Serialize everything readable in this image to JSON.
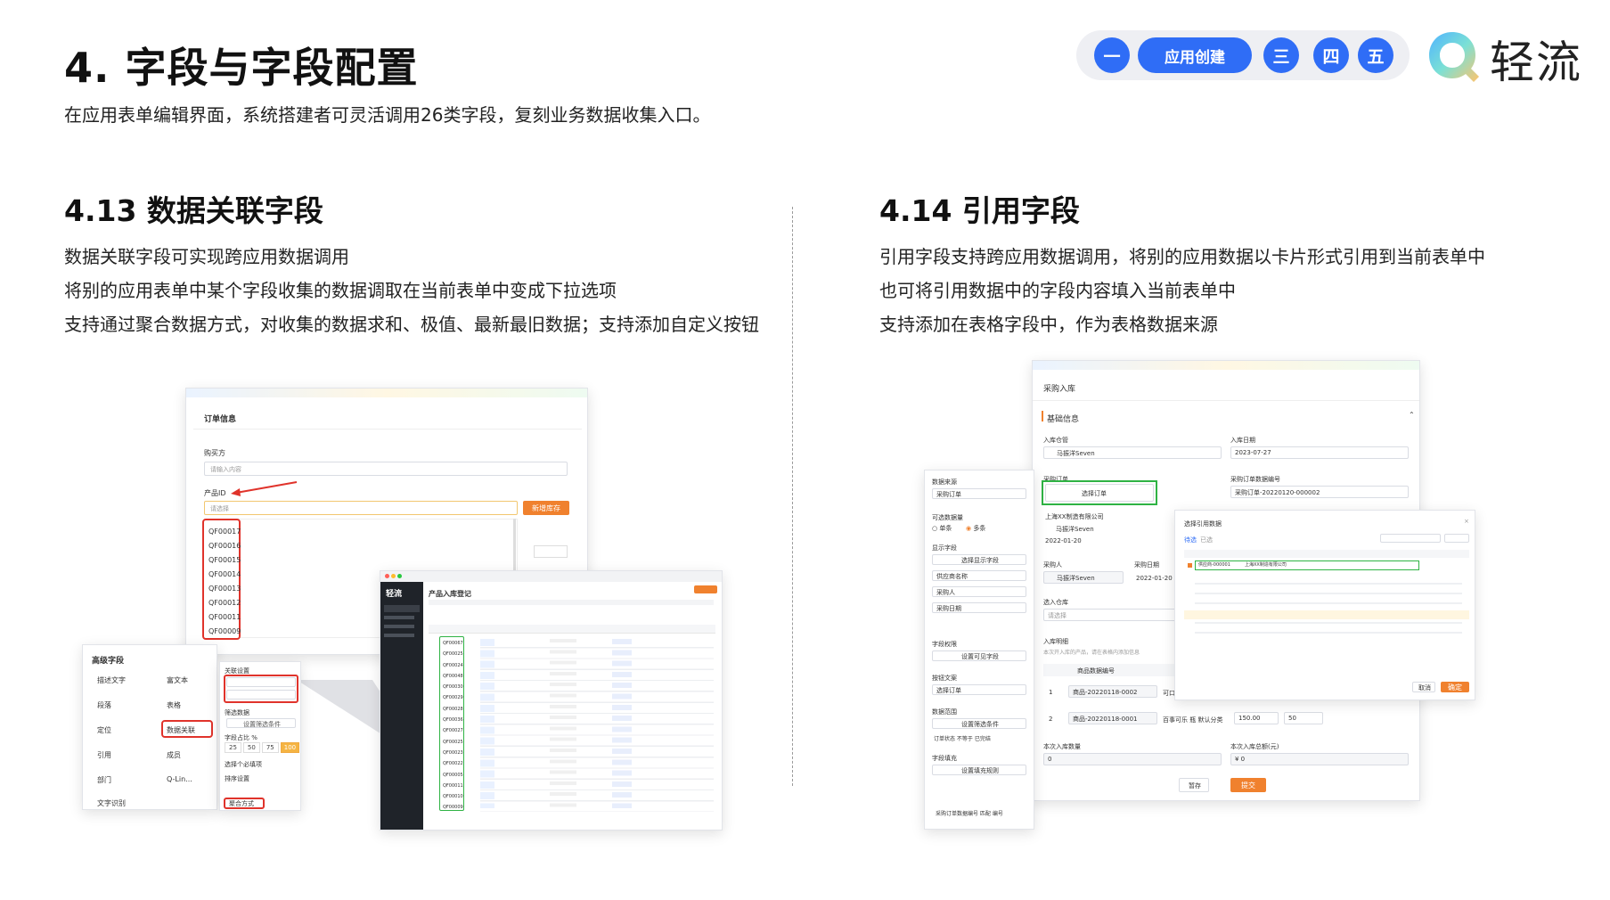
{
  "header": {
    "title": "4. 字段与字段配置",
    "subtitle": "在应用表单编辑界面，系统搭建者可灵活调用26类字段，复刻业务数据收集入口。"
  },
  "nav": {
    "items": [
      "一",
      "应用创建",
      "三",
      "四",
      "五"
    ],
    "active_color": "#2f6df6"
  },
  "logo": {
    "text": "轻流"
  },
  "left_section": {
    "title": "4.13 数据关联字段",
    "lines": [
      "数据关联字段可实现跨应用数据调用",
      "将别的应用表单中某个字段收集的数据调取在当前表单中变成下拉选项",
      "支持通过聚合数据方式，对收集的数据求和、极值、最新最旧数据；支持添加自定义按钮"
    ]
  },
  "right_section": {
    "title": "4.14 引用字段",
    "lines": [
      "引用字段支持跨应用数据调用，将别的应用数据以卡片形式引用到当前表单中",
      "也可将引用数据中的字段内容填入当前表单中",
      "支持添加在表格字段中，作为表格数据来源"
    ]
  },
  "mock_order": {
    "title": "订单信息",
    "buyer_label": "购买方",
    "buyer_placeholder": "请输入内容",
    "product_label": "产品ID",
    "select_placeholder": "请选择",
    "add_button": "新增库存",
    "options": [
      "QF00017",
      "QF00016",
      "QF00015",
      "QF00014",
      "QF00013",
      "QF00012",
      "QF00011",
      "QF00009"
    ]
  },
  "mock_fields": {
    "title": "高级字段",
    "items": [
      "描述文字",
      "富文本",
      "段落",
      "表格",
      "定位",
      "数据关联",
      "引用",
      "成员",
      "部门",
      "Q-Lin...",
      "文字识别"
    ],
    "config": {
      "label1": "关联设置",
      "label2": "筛选数据",
      "btn1": "设置筛选条件",
      "label3": "字段占比 %",
      "ratios": [
        "25",
        "50",
        "75",
        "100"
      ],
      "check1": "选择个必填项",
      "label4": "排序设置",
      "agg": "聚合方式"
    }
  },
  "mock_table": {
    "brand": "轻流",
    "page_title": "产品入库登记",
    "rows": [
      "QF00067",
      "QF00025",
      "QF00024",
      "QF00048",
      "QF00030",
      "QF00029",
      "QF00028",
      "QF00036",
      "QF00027",
      "QF00025",
      "QF00023",
      "QF00022",
      "QF00005",
      "QF00011",
      "QF00010",
      "QF00009"
    ]
  },
  "mock_purchase": {
    "title": "采购入库",
    "section": "基础信息",
    "warehouse_manager_label": "入库仓管",
    "warehouse_manager": "马振洋Seven",
    "date_label": "入库日期",
    "date": "2023-07-27",
    "order_label": "采购订单",
    "order_button": "选择订单",
    "order_no_label": "采购订单数据编号",
    "order_no": "采购订单-20220120-000002",
    "supplier": "上海XX制造有限公司",
    "person": "马振洋Seven",
    "order_date": "2022-01-20",
    "buyer_label": "采购人",
    "buyer": "马振洋Seven",
    "buy_date_label": "采购日期",
    "buy_date": "2022-01-20",
    "warehouse_label": "选入仓库",
    "warehouse_placeholder": "请选择",
    "detail_label": "入库明细",
    "detail_hint": "本次开入库的产品，请在表格内添加信息",
    "table_header": "商品数据编号",
    "table_rows": [
      {
        "idx": "1",
        "code": "商品-20220118-0002",
        "name": "可口"
      },
      {
        "idx": "2",
        "code": "商品-20220118-0001",
        "name": "百事可乐 瓶 默认分类",
        "price": "150.00",
        "qty": "50"
      }
    ],
    "total_qty_label": "本次入库数量",
    "total_qty": "0",
    "total_amount_label": "本次入库总额(元)",
    "total_amount": "¥ 0",
    "save_btn": "暂存",
    "submit_btn": "提交"
  },
  "mock_source": {
    "label1": "数据来源",
    "value1": "采购订单",
    "label2": "可选数据量",
    "opt1": "单条",
    "opt2": "多条",
    "label3": "显示字段",
    "btn3": "选择显示字段",
    "fields": [
      "供应商名称",
      "采购人",
      "采购日期"
    ],
    "label4": "字段权限",
    "btn4": "设置可见字段",
    "label5": "按钮文案",
    "value5": "选择订单",
    "label6": "数据范围",
    "btn6": "设置筛选条件",
    "filter": "订单状态 不等于 已完结",
    "label7": "字段填充",
    "btn7": "设置填充规则",
    "fill": "采购订单数据编号 匹配 编号"
  },
  "mock_dialog": {
    "title": "选择引用数据",
    "tab1": "待选",
    "tab2": "已选",
    "selected_row": "供应商-000001",
    "selected_row_company": "上海XX制造有限公司",
    "cancel": "取消",
    "confirm": "确定"
  }
}
